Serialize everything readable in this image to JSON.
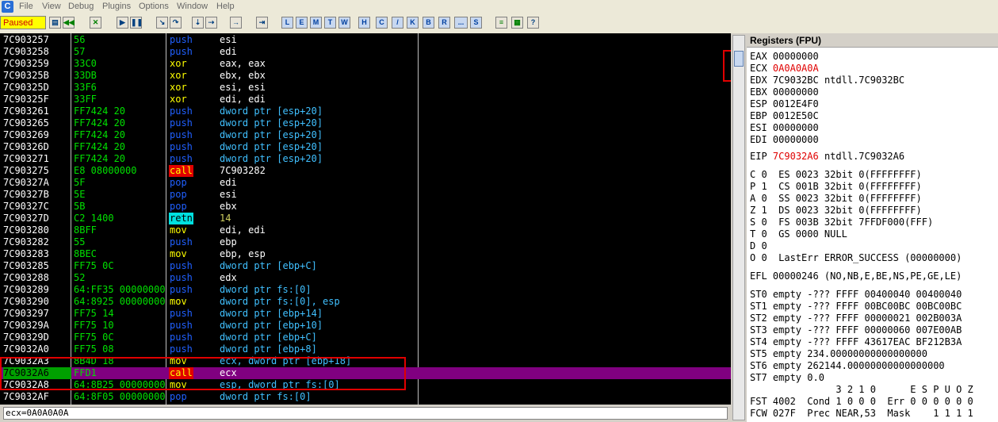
{
  "menu": {
    "app_icon": "C",
    "items": [
      "File",
      "View",
      "Debug",
      "Plugins",
      "Options",
      "Window",
      "Help"
    ]
  },
  "toolbar": {
    "status": "Paused",
    "icons": [
      "open-icon",
      "restart-icon",
      "close-icon",
      "run-icon",
      "pause-icon",
      "step-into-icon",
      "step-over-icon",
      "trace-into-icon",
      "trace-over-icon",
      "execute-till-return-icon",
      "goto-icon"
    ],
    "letters": [
      "L",
      "E",
      "M",
      "T",
      "W",
      "H",
      "C",
      "/",
      "K",
      "B",
      "R",
      "...",
      "S"
    ],
    "right_icons": [
      "list-icon",
      "grid-icon",
      "help-icon"
    ]
  },
  "disasm": [
    {
      "addr": "7C903257",
      "hex": "56",
      "mn": "push",
      "ops": "esi"
    },
    {
      "addr": "7C903258",
      "hex": "57",
      "mn": "push",
      "ops": "edi"
    },
    {
      "addr": "7C903259",
      "hex": "33C0",
      "mn": "xor",
      "ops": "eax, eax"
    },
    {
      "addr": "7C90325B",
      "hex": "33DB",
      "mn": "xor",
      "ops": "ebx, ebx"
    },
    {
      "addr": "7C90325D",
      "hex": "33F6",
      "mn": "xor",
      "ops": "esi, esi"
    },
    {
      "addr": "7C90325F",
      "hex": "33FF",
      "mn": "xor",
      "ops": "edi, edi"
    },
    {
      "addr": "7C903261",
      "hex": "FF7424 20",
      "mn": "push",
      "ops": "dword ptr [esp+20]"
    },
    {
      "addr": "7C903265",
      "hex": "FF7424 20",
      "mn": "push",
      "ops": "dword ptr [esp+20]"
    },
    {
      "addr": "7C903269",
      "hex": "FF7424 20",
      "mn": "push",
      "ops": "dword ptr [esp+20]"
    },
    {
      "addr": "7C90326D",
      "hex": "FF7424 20",
      "mn": "push",
      "ops": "dword ptr [esp+20]"
    },
    {
      "addr": "7C903271",
      "hex": "FF7424 20",
      "mn": "push",
      "ops": "dword ptr [esp+20]"
    },
    {
      "addr": "7C903275",
      "hex": "E8 08000000",
      "mn": "call",
      "ops": "7C903282"
    },
    {
      "addr": "7C90327A",
      "hex": "5F",
      "mn": "pop",
      "ops": "edi"
    },
    {
      "addr": "7C90327B",
      "hex": "5E",
      "mn": "pop",
      "ops": "esi"
    },
    {
      "addr": "7C90327C",
      "hex": "5B",
      "mn": "pop",
      "ops": "ebx"
    },
    {
      "addr": "7C90327D",
      "hex": "C2 1400",
      "mn": "retn",
      "ops": "14"
    },
    {
      "addr": "7C903280",
      "hex": "8BFF",
      "mn": "mov",
      "ops": "edi, edi"
    },
    {
      "addr": "7C903282",
      "hex": "55",
      "mn": "push",
      "ops": "ebp"
    },
    {
      "addr": "7C903283",
      "hex": "8BEC",
      "mn": "mov",
      "ops": "ebp, esp"
    },
    {
      "addr": "7C903285",
      "hex": "FF75 0C",
      "mn": "push",
      "ops": "dword ptr [ebp+C]"
    },
    {
      "addr": "7C903288",
      "hex": "52",
      "mn": "push",
      "ops": "edx"
    },
    {
      "addr": "7C903289",
      "hex": "64:FF35 00000000",
      "mn": "push",
      "ops": "dword ptr fs:[0]"
    },
    {
      "addr": "7C903290",
      "hex": "64:8925 00000000",
      "mn": "mov",
      "ops": "dword ptr fs:[0], esp"
    },
    {
      "addr": "7C903297",
      "hex": "FF75 14",
      "mn": "push",
      "ops": "dword ptr [ebp+14]"
    },
    {
      "addr": "7C90329A",
      "hex": "FF75 10",
      "mn": "push",
      "ops": "dword ptr [ebp+10]"
    },
    {
      "addr": "7C90329D",
      "hex": "FF75 0C",
      "mn": "push",
      "ops": "dword ptr [ebp+C]"
    },
    {
      "addr": "7C9032A0",
      "hex": "FF75 08",
      "mn": "push",
      "ops": "dword ptr [ebp+8]"
    },
    {
      "addr": "7C9032A3",
      "hex": "8B4D 18",
      "mn": "mov",
      "ops": "ecx, dword ptr [ebp+18]"
    },
    {
      "addr": "7C9032A6",
      "hex": "FFD1",
      "mn": "call",
      "ops": "ecx"
    },
    {
      "addr": "7C9032A8",
      "hex": "64:8B25 00000000",
      "mn": "mov",
      "ops": "esp, dword ptr fs:[0]"
    },
    {
      "addr": "7C9032AF",
      "hex": "64:8F05 00000000",
      "mn": "pop",
      "ops": "dword ptr fs:[0]"
    }
  ],
  "highlight_row": 28,
  "command_line": "ecx=0A0A0A0A",
  "registers": {
    "title": "Registers (FPU)",
    "lines": [
      {
        "name": "EAX",
        "value": "00000000",
        "extra": ""
      },
      {
        "name": "ECX",
        "value": "0A0A0A0A",
        "extra": "",
        "changed": true
      },
      {
        "name": "EDX",
        "value": "7C9032BC",
        "extra": "ntdll.7C9032BC"
      },
      {
        "name": "EBX",
        "value": "00000000",
        "extra": ""
      },
      {
        "name": "ESP",
        "value": "0012E4F0",
        "extra": ""
      },
      {
        "name": "EBP",
        "value": "0012E50C",
        "extra": ""
      },
      {
        "name": "ESI",
        "value": "00000000",
        "extra": ""
      },
      {
        "name": "EDI",
        "value": "00000000",
        "extra": ""
      }
    ],
    "eip": {
      "name": "EIP",
      "value": "7C9032A6",
      "extra": "ntdll.7C9032A6"
    },
    "flags": [
      "C 0  ES 0023 32bit 0(FFFFFFFF)",
      "P 1  CS 001B 32bit 0(FFFFFFFF)",
      "A 0  SS 0023 32bit 0(FFFFFFFF)",
      "Z 1  DS 0023 32bit 0(FFFFFFFF)",
      "S 0  FS 003B 32bit 7FFDF000(FFF)",
      "T 0  GS 0000 NULL",
      "D 0",
      "O 0  LastErr ERROR_SUCCESS (00000000)"
    ],
    "efl": "EFL 00000246 (NO,NB,E,BE,NS,PE,GE,LE)",
    "fpu": [
      "ST0 empty -??? FFFF 00400040 00400040",
      "ST1 empty -??? FFFF 00BC00BC 00BC00BC",
      "ST2 empty -??? FFFF 00000021 002B003A",
      "ST3 empty -??? FFFF 00000060 007E00AB",
      "ST4 empty -??? FFFF 43617EAC BF212B3A",
      "ST5 empty 234.00000000000000000",
      "ST6 empty 262144.00000000000000000",
      "ST7 empty 0.0"
    ],
    "fpu_status": [
      "               3 2 1 0      E S P U O Z",
      "FST 4002  Cond 1 0 0 0  Err 0 0 0 0 0 0",
      "FCW 027F  Prec NEAR,53  Mask    1 1 1 1"
    ]
  },
  "colors": {
    "highlight": "#800080",
    "annotation": "#e00000"
  }
}
